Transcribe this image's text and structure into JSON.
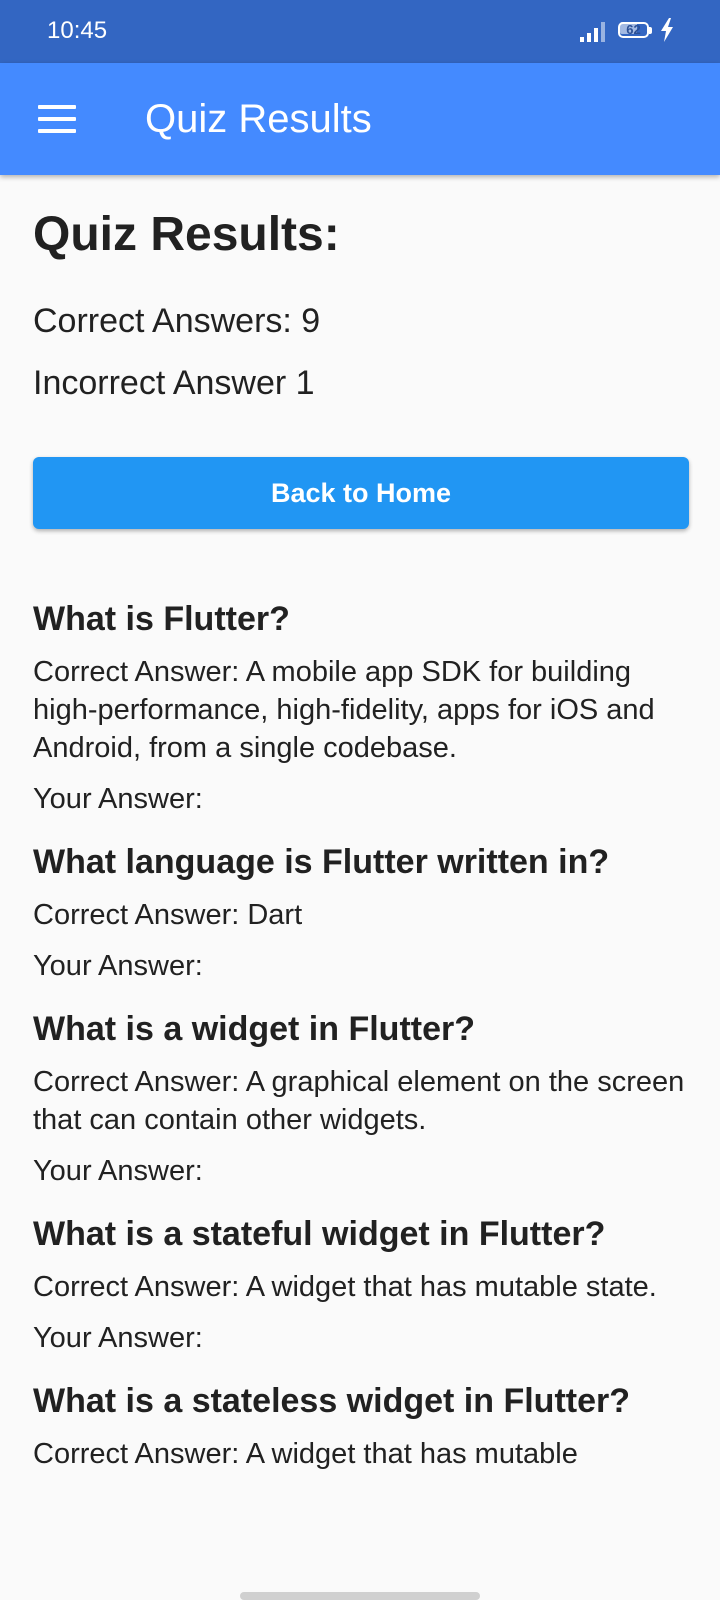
{
  "status_bar": {
    "time": "10:45",
    "battery_level": "62",
    "battery_fraction": 0.62,
    "signal_icon": "signal-icon",
    "charging_icon": "charging-bolt-icon"
  },
  "app_bar": {
    "title": "Quiz Results",
    "menu_icon": "hamburger-menu-icon",
    "color": "#448aff"
  },
  "results": {
    "heading": "Quiz Results:",
    "correct_line": "Correct Answers: 9",
    "incorrect_line": "Incorrect Answer 1"
  },
  "home_button": {
    "label": "Back to Home",
    "color": "#2196f3"
  },
  "questions": [
    {
      "question": "What is Flutter?",
      "correct": "Correct Answer: A mobile app SDK for building high-performance, high-fidelity, apps for iOS and Android, from a single codebase.",
      "your_answer": "Your Answer:"
    },
    {
      "question": "What language is Flutter written in?",
      "correct": "Correct Answer: Dart",
      "your_answer": "Your Answer:"
    },
    {
      "question": "What is a widget in Flutter?",
      "correct": "Correct Answer: A graphical element on the screen that can contain other widgets.",
      "your_answer": "Your Answer:"
    },
    {
      "question": "What is a stateful widget in Flutter?",
      "correct": "Correct Answer: A widget that has mutable state.",
      "your_answer": "Your Answer:"
    },
    {
      "question": "What is a stateless widget in Flutter?",
      "correct": "Correct Answer: A widget that has mutable",
      "your_answer": ""
    }
  ]
}
